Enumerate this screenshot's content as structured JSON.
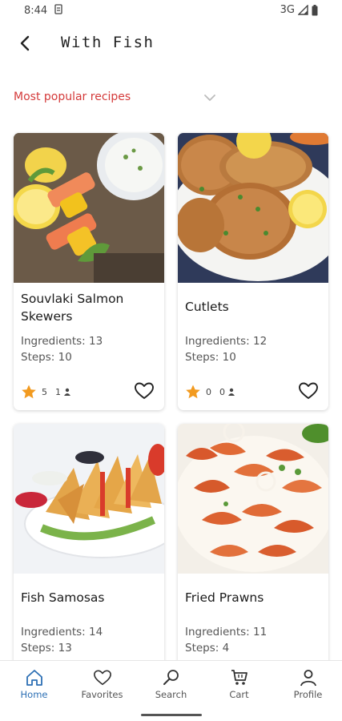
{
  "status_bar": {
    "time": "8:44",
    "network": "3G"
  },
  "header": {
    "title": "With Fish",
    "back_icon": "arrow-back-icon"
  },
  "sort": {
    "label": "Most popular recipes",
    "icon": "chevron-down-icon"
  },
  "recipes": [
    {
      "name": "Souvlaki Salmon Skewers",
      "ingredients": "Ingredients: 13",
      "steps": "Steps: 10",
      "rating": "5",
      "ratings_count": "1"
    },
    {
      "name": "Cutlets",
      "ingredients": "Ingredients: 12",
      "steps": "Steps: 10",
      "rating": "0",
      "ratings_count": "0"
    },
    {
      "name": "Fish Samosas",
      "ingredients": "Ingredients: 14",
      "steps": "Steps: 13"
    },
    {
      "name": "Fried Prawns",
      "ingredients": "Ingredients: 11",
      "steps": "Steps: 4"
    }
  ],
  "bottom_nav": {
    "items": [
      {
        "label": "Home",
        "icon": "home-icon",
        "active": true
      },
      {
        "label": "Favorites",
        "icon": "heart-icon",
        "active": false
      },
      {
        "label": "Search",
        "icon": "search-icon",
        "active": false
      },
      {
        "label": "Cart",
        "icon": "cart-icon",
        "active": false
      },
      {
        "label": "Profile",
        "icon": "person-icon",
        "active": false
      }
    ]
  },
  "colors": {
    "accent": "#d43a3a",
    "nav_active": "#2c6fb4",
    "star": "#f29a1f"
  }
}
